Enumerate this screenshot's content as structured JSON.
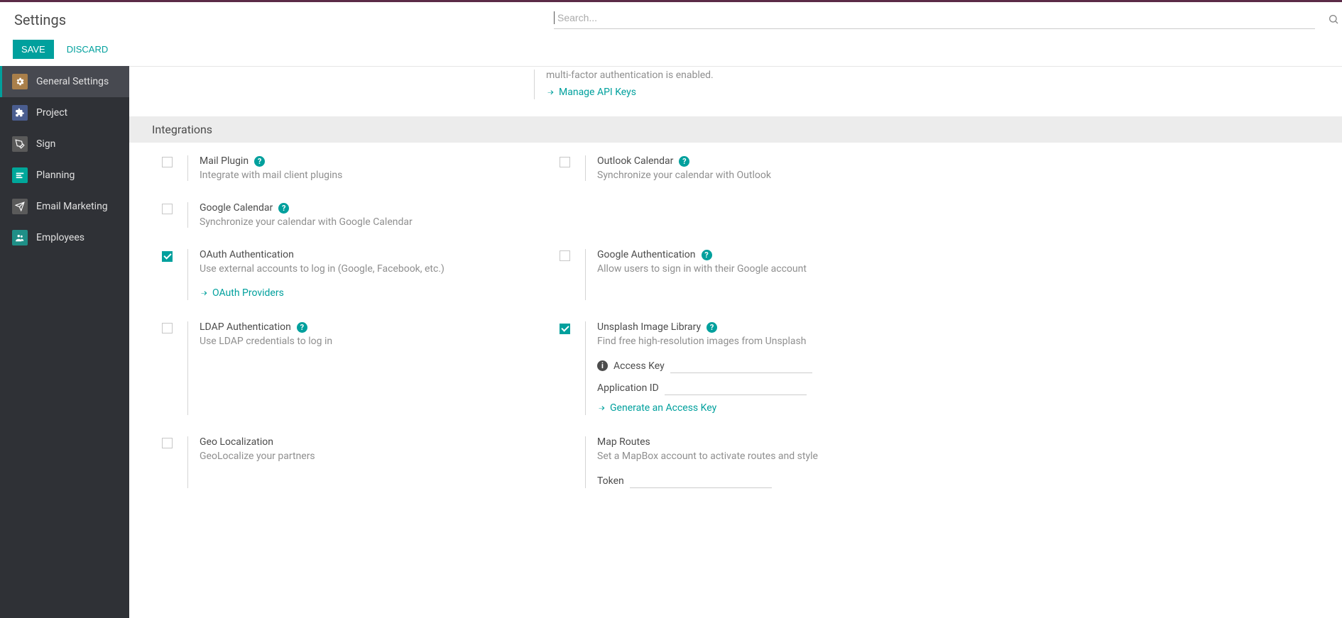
{
  "page_title": "Settings",
  "search": {
    "placeholder": "Search..."
  },
  "actions": {
    "save": "SAVE",
    "discard": "DISCARD"
  },
  "sidebar": {
    "items": [
      {
        "label": "General Settings"
      },
      {
        "label": "Project"
      },
      {
        "label": "Sign"
      },
      {
        "label": "Planning"
      },
      {
        "label": "Email Marketing"
      },
      {
        "label": "Employees"
      }
    ]
  },
  "mfa_fragment": {
    "text": "multi-factor authentication is enabled.",
    "link": "Manage API Keys"
  },
  "section": {
    "title": "Integrations",
    "mail_plugin": {
      "title": "Mail Plugin",
      "desc": "Integrate with mail client plugins"
    },
    "outlook_calendar": {
      "title": "Outlook Calendar",
      "desc": "Synchronize your calendar with Outlook"
    },
    "google_calendar": {
      "title": "Google Calendar",
      "desc": "Synchronize your calendar with Google Calendar"
    },
    "oauth": {
      "title": "OAuth Authentication",
      "desc": "Use external accounts to log in (Google, Facebook, etc.)",
      "link": "OAuth Providers"
    },
    "google_auth": {
      "title": "Google Authentication",
      "desc": "Allow users to sign in with their Google account"
    },
    "ldap": {
      "title": "LDAP Authentication",
      "desc": "Use LDAP credentials to log in"
    },
    "unsplash": {
      "title": "Unsplash Image Library",
      "desc": "Find free high-resolution images from Unsplash",
      "access_key_label": "Access Key",
      "app_id_label": "Application ID",
      "link": "Generate an Access Key"
    },
    "geo": {
      "title": "Geo Localization",
      "desc": "GeoLocalize your partners"
    },
    "map_routes": {
      "title": "Map Routes",
      "desc": "Set a MapBox account to activate routes and style",
      "token_label": "Token"
    }
  }
}
